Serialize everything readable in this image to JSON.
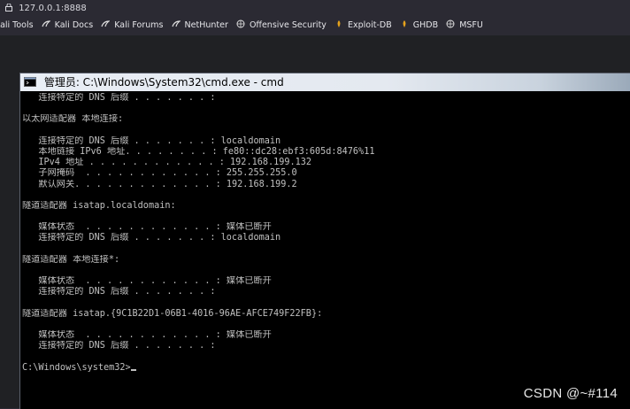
{
  "browser": {
    "url": "127.0.0.1:8888",
    "bookmarks": [
      {
        "label": "Kali Tools",
        "icon": "kali-icon"
      },
      {
        "label": "Kali Docs",
        "icon": "kali-docs-icon"
      },
      {
        "label": "Kali Forums",
        "icon": "kali-forums-icon"
      },
      {
        "label": "NetHunter",
        "icon": "nethunter-icon"
      },
      {
        "label": "Offensive Security",
        "icon": "offsec-icon"
      },
      {
        "label": "Exploit-DB",
        "icon": "exploitdb-icon"
      },
      {
        "label": "GHDB",
        "icon": "ghdb-icon"
      },
      {
        "label": "MSFU",
        "icon": "msfu-icon"
      }
    ]
  },
  "cmd": {
    "title": "管理员: C:\\Windows\\System32\\cmd.exe - cmd",
    "lines": [
      "   连接特定的 DNS 后缀 . . . . . . . :",
      "",
      "以太网适配器 本地连接:",
      "",
      "   连接特定的 DNS 后缀 . . . . . . . : localdomain",
      "   本地链接 IPv6 地址. . . . . . . . : fe80::dc28:ebf3:605d:8476%11",
      "   IPv4 地址 . . . . . . . . . . . . : 192.168.199.132",
      "   子网掩码  . . . . . . . . . . . . : 255.255.255.0",
      "   默认网关. . . . . . . . . . . . . : 192.168.199.2",
      "",
      "隧道适配器 isatap.localdomain:",
      "",
      "   媒体状态  . . . . . . . . . . . . : 媒体已断开",
      "   连接特定的 DNS 后缀 . . . . . . . : localdomain",
      "",
      "隧道适配器 本地连接*:",
      "",
      "   媒体状态  . . . . . . . . . . . . : 媒体已断开",
      "   连接特定的 DNS 后缀 . . . . . . . :",
      "",
      "隧道适配器 isatap.{9C1B22D1-06B1-4016-96AE-AFCE749F22FB}:",
      "",
      "   媒体状态  . . . . . . . . . . . . : 媒体已断开",
      "   连接特定的 DNS 后缀 . . . . . . . :",
      "",
      "C:\\Windows\\system32>"
    ]
  },
  "watermark": "CSDN @~#114",
  "colors": {
    "browser_bg": "#2b2a33",
    "console_bg": "#000000",
    "console_text": "#c0c0c0"
  }
}
